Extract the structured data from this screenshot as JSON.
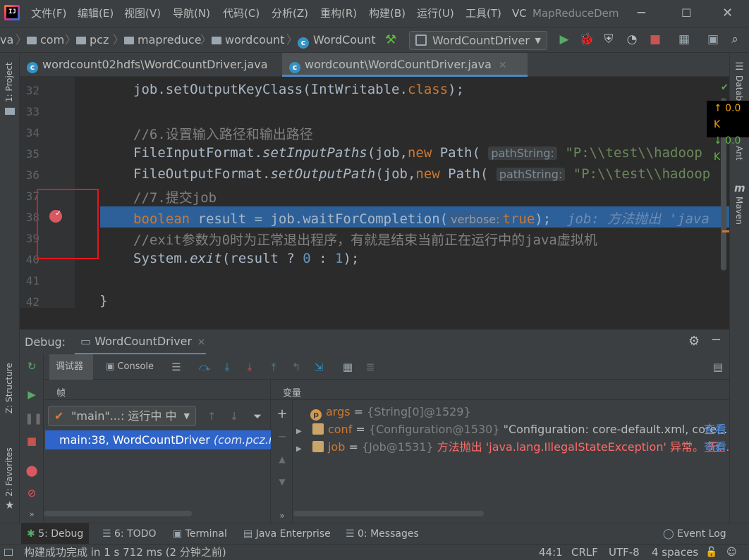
{
  "menu": {
    "items": [
      "文件(F)",
      "编辑(E)",
      "视图(V)",
      "导航(N)",
      "代码(C)",
      "分析(Z)",
      "重构(R)",
      "构建(B)",
      "运行(U)",
      "工具(T)",
      "VC"
    ],
    "window_title": "MapReduceDem"
  },
  "breadcrumb": [
    "va",
    "com",
    "pcz",
    "mapreduce",
    "wordcount",
    "WordCount"
  ],
  "run_config": "WordCountDriver",
  "tabs": [
    {
      "label": "wordcount02hdfs\\WordCountDriver.java",
      "active": false
    },
    {
      "label": "wordcount\\WordCountDriver.java",
      "active": true
    }
  ],
  "side_tools": {
    "left_top": "1: Project",
    "left_mid": "Z: Structure",
    "left_bottom": "2: Favorites",
    "right_database": "Datab",
    "right_ant": "Ant",
    "right_maven": "Maven"
  },
  "network": {
    "up": "↑ 0.0 K",
    "down": "↓ 0.0 K"
  },
  "code": {
    "lines": [
      {
        "n": "32",
        "t": ""
      },
      {
        "n": "33",
        "t": ""
      },
      {
        "n": "34",
        "t": ""
      },
      {
        "n": "35",
        "t": ""
      },
      {
        "n": "36",
        "t": ""
      },
      {
        "n": "37",
        "t": ""
      },
      {
        "n": "38",
        "t": ""
      },
      {
        "n": "39",
        "t": ""
      },
      {
        "n": "40",
        "t": ""
      },
      {
        "n": "41",
        "t": ""
      },
      {
        "n": "42",
        "t": ""
      }
    ],
    "l32": {
      "a": "job.setOutputKeyClass(IntWritable.",
      "b": "class",
      "c": ");"
    },
    "l34": "//6.设置输入路径和输出路径",
    "l35": {
      "a": "FileInputFormat.",
      "b": "setInputPaths",
      "c": "(job,",
      "d": "new",
      "e": " Path(",
      "hint": "pathString:",
      "s": "\"P:\\\\test\\\\hadoop"
    },
    "l36": {
      "a": "FileOutputFormat.",
      "b": "setOutputPath",
      "c": "(job,",
      "d": "new",
      "e": " Path(",
      "hint": "pathString:",
      "s": "\"P:\\\\test\\\\hadoop"
    },
    "l37": "//7.提交job",
    "l38": {
      "a": "boolean",
      "b": " result = job.waitForCompletion(",
      "hint": "verbose:",
      "c": "true",
      "d": ");",
      "inline": "job: 方法抛出 'java"
    },
    "l39": "//exit参数为0时为正常退出程序，有就是结束当前正在运行中的java虚拟机",
    "l40": {
      "a": "System.",
      "b": "exit",
      "c": "(result ? ",
      "d": "0",
      "e": " : ",
      "f": "1",
      "g": ");"
    },
    "l42": "}"
  },
  "debug": {
    "title": "Debug:",
    "session": "WordCountDriver",
    "tab_debugger": "调试器",
    "tab_console": "Console",
    "frames_header": "帧",
    "vars_header": "变量",
    "thread": "\"main\"...: 运行中 中",
    "frame": {
      "main": "main:38, WordCountDriver ",
      "pkg": "(com.pcz.ma"
    },
    "variables": [
      {
        "icon": "p",
        "expand": false,
        "name": "args",
        "eq": " = ",
        "type": "{String[0]@1529}",
        "value": "",
        "link": ""
      },
      {
        "icon": "f",
        "expand": true,
        "name": "conf",
        "eq": " = ",
        "type": "{Configuration@1530}",
        "value": " \"Configuration: core-default.xml, core...",
        "link": "查看"
      },
      {
        "icon": "f",
        "expand": true,
        "name": "job",
        "eq": " = ",
        "type": "{Job@1531}",
        "value": " 方法抛出 'java.lang.IllegalStateException' 异常。 无...",
        "link": "查看"
      }
    ]
  },
  "bottom_tabs": [
    "5: Debug",
    "6: TODO",
    "Terminal",
    "Java Enterprise",
    "0: Messages",
    "Event Log"
  ],
  "status": {
    "message": "构建成功完成 in 1 s 712 ms (2 分钟之前)",
    "position": "44:1",
    "line_sep": "CRLF",
    "encoding": "UTF-8",
    "indent": "4 spaces"
  },
  "colors": {
    "accent": "#4a88c7",
    "selection": "#2f65ca",
    "current_line": "#2d6099",
    "breakpoint": "#db5860",
    "annotation_box": "#e5171d"
  }
}
